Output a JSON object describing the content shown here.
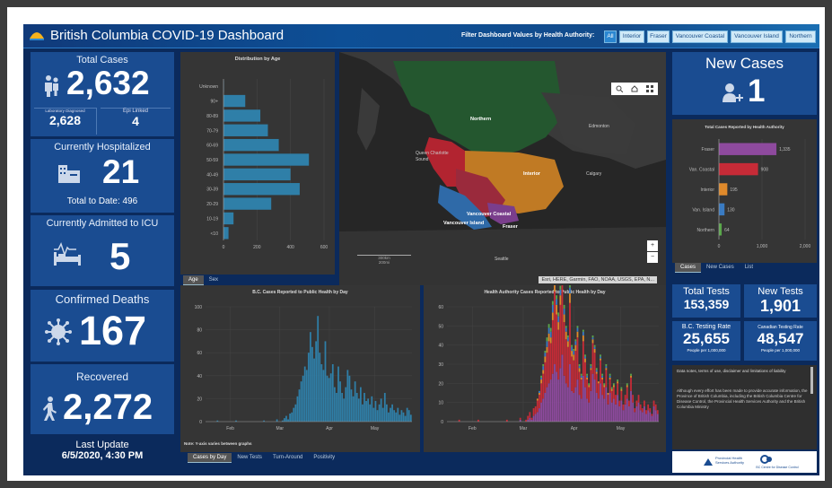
{
  "header": {
    "title": "British Columbia COVID-19 Dashboard",
    "filter_label": "Filter Dashboard Values by Health Authority:",
    "filters": [
      "All",
      "Interior",
      "Fraser",
      "Vancouver Coastal",
      "Vancouver Island",
      "Northern"
    ]
  },
  "total_cases": {
    "label": "Total Cases",
    "value": "2,632",
    "lab_label": "Laboratory Diagnosed",
    "lab_value": "2,628",
    "epi_label": "Epi Linked",
    "epi_value": "4"
  },
  "hospitalized": {
    "label": "Currently Hospitalized",
    "value": "21",
    "sub": "Total to Date: 496"
  },
  "icu": {
    "label": "Currently Admitted to ICU",
    "value": "5"
  },
  "deaths": {
    "label": "Confirmed Deaths",
    "value": "167"
  },
  "recovered": {
    "label": "Recovered",
    "value": "2,272"
  },
  "last_update": {
    "label": "Last Update",
    "value": "6/5/2020, 4:30 PM"
  },
  "new_cases": {
    "label": "New Cases",
    "value": "1"
  },
  "age_panel": {
    "title": "Distribution by Age",
    "tabs": [
      "Age",
      "Sex"
    ]
  },
  "ha_panel": {
    "title": "Total Cases Reported by Health Authority",
    "tabs": [
      "Cases",
      "New Cases",
      "List"
    ]
  },
  "map": {
    "labels": [
      "Northern",
      "Edmonton",
      "Interior",
      "Calgary",
      "Vancouver Coastal",
      "Vancouver Island",
      "Fraser",
      "Seattle",
      "Queen Charlotte Sound"
    ],
    "scale_top": "300km",
    "scale_bottom": "200mi",
    "attribution": "Esri, HERE, Garmin, FAO, NOAA, USGS, EPA, N...",
    "zoom_in": "+",
    "zoom_out": "−"
  },
  "bc_chart": {
    "title": "B.C. Cases Reported to Public Health by Day",
    "note": "Note: Y-axis varies between graphs",
    "tabs": [
      "Cases by Day",
      "New Tests",
      "Turn-Around",
      "Positivity"
    ]
  },
  "ha_chart": {
    "title": "Health Authority Cases Reported to Public Health by Day"
  },
  "tests": {
    "total_label": "Total Tests",
    "total_value": "153,359",
    "new_label": "New Tests",
    "new_value": "1,901",
    "bc_rate_label": "B.C. Testing Rate",
    "bc_rate_value": "25,655",
    "bc_rate_sub": "People per 1,000,000",
    "ca_rate_label": "Canadian Testing Rate",
    "ca_rate_value": "48,547",
    "ca_rate_sub": "People per 1,000,000"
  },
  "notes": {
    "title": "Data notes, terms of use, disclaimer and limitations of liability",
    "body": "Although every effort has been made to provide accurate information, the Province of British Columbia, including the British Columbia Centre for Disease Control, the Provincial Health Services Authority and the British Columbia Ministry",
    "logo1": "Provincial Health Services Authority",
    "logo2": "BC Centre for Disease Control"
  },
  "colors": {
    "card": "#1a4c91",
    "bg": "#0b2a5c",
    "bar": "#2f7fa8",
    "fraser": "#8e4a9e",
    "vc": "#c62b37",
    "interior": "#e08a2b",
    "vi": "#3a7bc2",
    "northern": "#5aa84b"
  },
  "chart_data": [
    {
      "type": "bar",
      "title": "Distribution by Age",
      "categories": [
        "Unknown",
        "90+",
        "80-89",
        "70-79",
        "60-69",
        "50-59",
        "40-49",
        "30-39",
        "20-29",
        "10-19",
        "<10"
      ],
      "values": [
        2,
        130,
        220,
        265,
        330,
        510,
        400,
        455,
        285,
        60,
        30
      ],
      "xlim": [
        0,
        600
      ],
      "xticks": [
        "0",
        "200",
        "400",
        "600"
      ]
    },
    {
      "type": "bar",
      "title": "Total Cases Reported by Health Authority",
      "categories": [
        "Fraser",
        "Van. Coastal",
        "Interior",
        "Van. Island",
        "Northern"
      ],
      "values": [
        1335,
        908,
        195,
        130,
        64
      ],
      "value_labels": [
        "1,335",
        "908",
        "195",
        "130",
        "64"
      ],
      "xlim": [
        0,
        2000
      ],
      "xticks": [
        "0",
        "1,000",
        "2,000"
      ]
    },
    {
      "type": "bar",
      "title": "B.C. Cases Reported to Public Health by Day",
      "ylim": [
        0,
        100
      ],
      "yticks": [
        "0",
        "20",
        "40",
        "60",
        "80",
        "100"
      ],
      "xticks": [
        "Feb",
        "Mar",
        "Apr",
        "May"
      ],
      "series": [
        {
          "name": "",
          "values": [
            0,
            0,
            0,
            0,
            0,
            0,
            1,
            0,
            0,
            0,
            0,
            0,
            0,
            0,
            0,
            0,
            1,
            0,
            0,
            0,
            0,
            0,
            0,
            0,
            0,
            0,
            0,
            0,
            0,
            0,
            0,
            1,
            0,
            0,
            0,
            0,
            0,
            0,
            2,
            0,
            0,
            1,
            3,
            5,
            2,
            7,
            8,
            12,
            15,
            22,
            28,
            35,
            40,
            48,
            45,
            60,
            78,
            65,
            55,
            70,
            92,
            60,
            50,
            45,
            70,
            40,
            38,
            42,
            50,
            30,
            25,
            48,
            35,
            25,
            20,
            30,
            45,
            40,
            28,
            22,
            35,
            25,
            20,
            30,
            15,
            25,
            18,
            20,
            15,
            22,
            12,
            18,
            10,
            15,
            20,
            12,
            25,
            15,
            8,
            12,
            15,
            10,
            8,
            12,
            6,
            10,
            8,
            5,
            12,
            10,
            6
          ]
        }
      ]
    },
    {
      "type": "bar",
      "title": "Health Authority Cases Reported to Public Health by Day",
      "ylim": [
        0,
        60
      ],
      "yticks": [
        "0",
        "10",
        "20",
        "30",
        "40",
        "50",
        "60"
      ],
      "xticks": [
        "Feb",
        "Mar",
        "Apr",
        "May"
      ],
      "series": [
        {
          "name": "Fraser",
          "values": [
            0,
            0,
            0,
            0,
            0,
            0,
            0,
            0,
            0,
            0,
            0,
            0,
            0,
            0,
            0,
            0,
            0,
            0,
            0,
            0,
            0,
            0,
            0,
            0,
            0,
            0,
            0,
            0,
            0,
            0,
            0,
            0,
            0,
            0,
            0,
            0,
            0,
            0,
            1,
            0,
            0,
            0,
            1,
            2,
            1,
            3,
            4,
            5,
            7,
            10,
            12,
            15,
            18,
            20,
            22,
            25,
            30,
            26,
            22,
            28,
            35,
            24,
            20,
            18,
            30,
            16,
            15,
            18,
            22,
            14,
            12,
            24,
            18,
            12,
            10,
            16,
            25,
            22,
            15,
            12,
            20,
            14,
            12,
            18,
            9,
            15,
            10,
            12,
            9,
            14,
            8,
            11,
            6,
            9,
            12,
            8,
            16,
            10,
            5,
            8,
            10,
            6,
            5,
            8,
            4,
            6,
            5,
            3,
            8,
            6,
            4
          ]
        },
        {
          "name": "Vancouver Coastal",
          "values": [
            0,
            0,
            0,
            0,
            0,
            0,
            1,
            0,
            0,
            0,
            0,
            0,
            0,
            0,
            0,
            0,
            1,
            0,
            0,
            0,
            0,
            0,
            0,
            0,
            0,
            0,
            0,
            0,
            0,
            0,
            0,
            1,
            0,
            0,
            0,
            0,
            0,
            0,
            1,
            0,
            0,
            1,
            2,
            3,
            1,
            4,
            4,
            6,
            7,
            10,
            13,
            16,
            18,
            22,
            19,
            28,
            38,
            30,
            26,
            33,
            45,
            28,
            23,
            21,
            32,
            18,
            17,
            19,
            22,
            12,
            10,
            18,
            13,
            10,
            8,
            11,
            16,
            14,
            10,
            8,
            12,
            8,
            6,
            9,
            5,
            7,
            6,
            6,
            5,
            6,
            3,
            5,
            3,
            5,
            6,
            3,
            7,
            4,
            2,
            3,
            4,
            3,
            2,
            3,
            2,
            3,
            2,
            1,
            3,
            3,
            2
          ]
        },
        {
          "name": "Interior",
          "values": [
            0,
            0,
            0,
            0,
            0,
            0,
            0,
            0,
            0,
            0,
            0,
            0,
            0,
            0,
            0,
            0,
            0,
            0,
            0,
            0,
            0,
            0,
            0,
            0,
            0,
            0,
            0,
            0,
            0,
            0,
            0,
            0,
            0,
            0,
            0,
            0,
            0,
            0,
            0,
            0,
            0,
            0,
            0,
            0,
            0,
            0,
            0,
            1,
            1,
            2,
            2,
            3,
            3,
            4,
            3,
            4,
            5,
            5,
            4,
            5,
            6,
            4,
            4,
            3,
            5,
            3,
            3,
            3,
            3,
            2,
            1,
            3,
            2,
            1,
            1,
            1,
            2,
            2,
            1,
            1,
            1,
            1,
            1,
            1,
            1,
            1,
            1,
            1,
            0,
            1,
            0,
            1,
            0,
            0,
            1,
            0,
            1,
            0,
            0,
            0,
            0,
            0,
            0,
            0,
            0,
            0,
            0,
            0,
            0,
            0,
            0
          ]
        },
        {
          "name": "Vancouver Island",
          "values": [
            0,
            0,
            0,
            0,
            0,
            0,
            0,
            0,
            0,
            0,
            0,
            0,
            0,
            0,
            0,
            0,
            0,
            0,
            0,
            0,
            0,
            0,
            0,
            0,
            0,
            0,
            0,
            0,
            0,
            0,
            0,
            0,
            0,
            0,
            0,
            0,
            0,
            0,
            0,
            0,
            0,
            0,
            0,
            0,
            0,
            0,
            0,
            0,
            1,
            1,
            2,
            2,
            3,
            3,
            3,
            4,
            4,
            3,
            3,
            3,
            4,
            3,
            2,
            2,
            3,
            2,
            2,
            2,
            2,
            1,
            1,
            2,
            1,
            1,
            0,
            1,
            1,
            1,
            1,
            0,
            1,
            1,
            0,
            1,
            0,
            1,
            0,
            0,
            0,
            0,
            0,
            0,
            0,
            0,
            0,
            0,
            0,
            0,
            0,
            0,
            0,
            0,
            0,
            0,
            0,
            0,
            0,
            0,
            0,
            0,
            0
          ]
        },
        {
          "name": "Northern",
          "values": [
            0,
            0,
            0,
            0,
            0,
            0,
            0,
            0,
            0,
            0,
            0,
            0,
            0,
            0,
            0,
            0,
            0,
            0,
            0,
            0,
            0,
            0,
            0,
            0,
            0,
            0,
            0,
            0,
            0,
            0,
            0,
            0,
            0,
            0,
            0,
            0,
            0,
            0,
            0,
            0,
            0,
            0,
            0,
            0,
            0,
            0,
            0,
            0,
            0,
            1,
            1,
            1,
            2,
            2,
            2,
            2,
            3,
            2,
            2,
            2,
            3,
            2,
            1,
            1,
            2,
            1,
            1,
            1,
            1,
            1,
            1,
            1,
            1,
            1,
            1,
            1,
            1,
            1,
            1,
            0,
            1,
            1,
            1,
            1,
            0,
            1,
            1,
            1,
            0,
            1,
            0,
            1,
            0,
            0,
            1,
            0,
            1,
            0,
            0,
            0,
            0,
            0,
            0,
            0,
            0,
            0,
            0,
            0,
            0,
            0,
            0
          ]
        }
      ]
    }
  ]
}
